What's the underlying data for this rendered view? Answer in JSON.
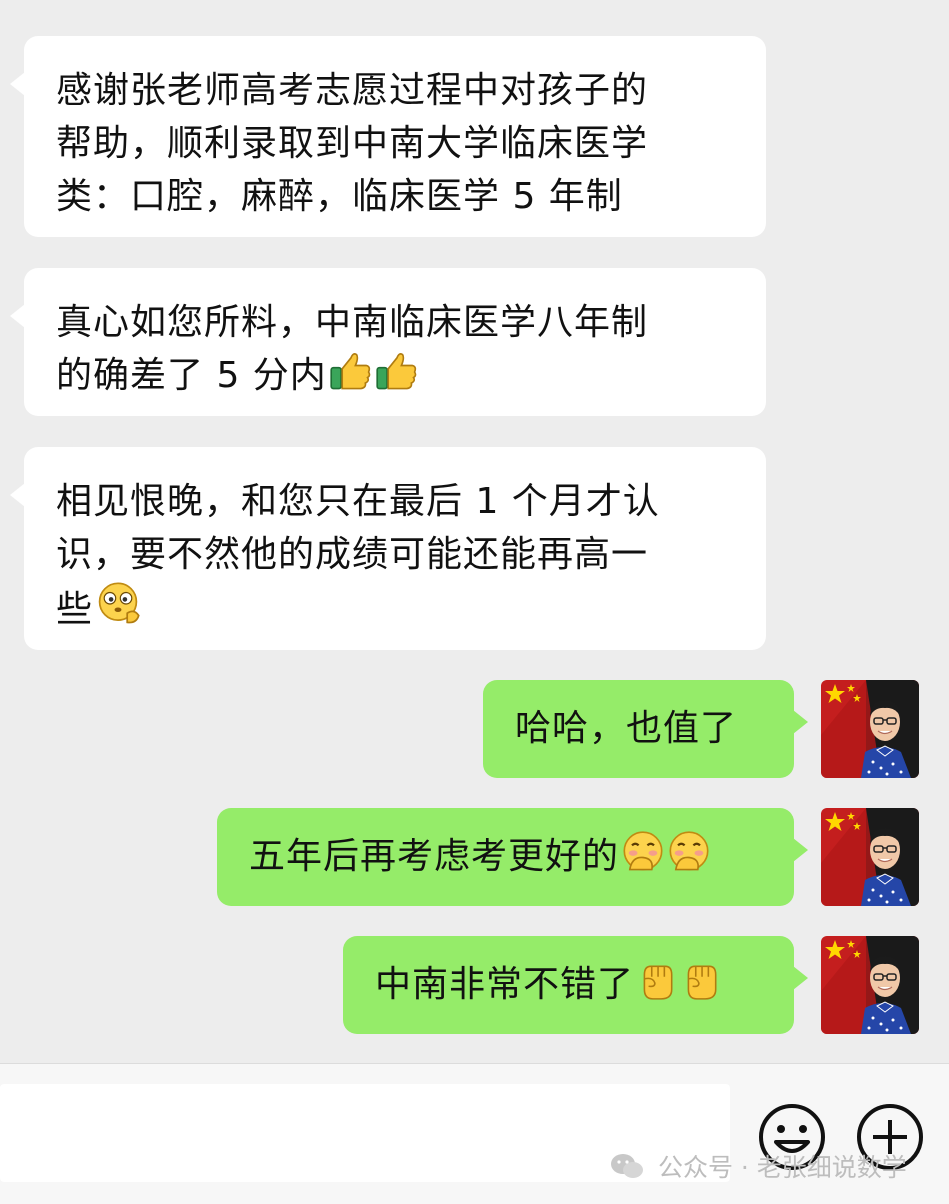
{
  "messages": [
    {
      "side": "incoming",
      "lines": [
        "感谢张老师高考志愿过程中对孩子的",
        "帮助，顺利录取到中南大学临床医学",
        "类：口腔，麻醉，临床医学 5 年制"
      ]
    },
    {
      "side": "incoming",
      "lines": [
        "真心如您所料，中南临床医学八年制",
        "的确差了 5 分内"
      ],
      "emoji": [
        "thumbs-up",
        "thumbs-up"
      ]
    },
    {
      "side": "incoming",
      "lines": [
        "相见恨晚，和您只在最后 1 个月才认",
        "识，要不然他的成绩可能还能再高一",
        "些"
      ],
      "emoji": [
        "thinking-face"
      ]
    },
    {
      "side": "outgoing",
      "text": "哈哈，也值了"
    },
    {
      "side": "outgoing",
      "text": "五年后再考虑考更好的",
      "emoji": [
        "blushing-hand-over-mouth",
        "blushing-hand-over-mouth"
      ]
    },
    {
      "side": "outgoing",
      "text": "中南非常不错了",
      "emoji": [
        "fist",
        "fist"
      ]
    }
  ],
  "colors": {
    "background": "#ededed",
    "incoming_bubble": "#ffffff",
    "outgoing_bubble": "#95ec69"
  },
  "bottom_bar": {
    "emoji_button_icon": "smiley-icon",
    "more_button_icon": "plus-circle-icon"
  },
  "watermark": {
    "text": "公众号 · 老张细说数学",
    "icon": "wechat-icon"
  }
}
